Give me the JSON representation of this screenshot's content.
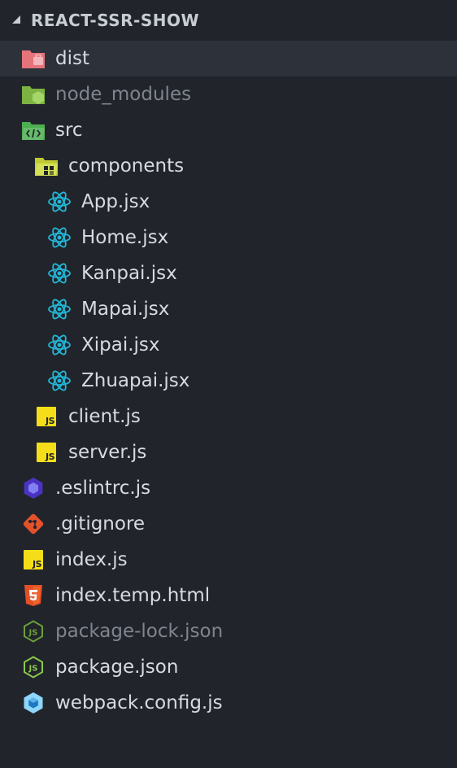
{
  "explorer": {
    "title": "REACT-SSR-SHOW"
  },
  "colors": {
    "background": "#21252b",
    "selected_row": "#2c313a",
    "text": "#d7dae0",
    "dim_text": "#7f848e",
    "react_blue": "#23b7d8",
    "js_yellow": "#f5de19",
    "git_orange": "#e4512b",
    "html_orange": "#e34f26",
    "node_green": "#8cc84b",
    "eslint_purple": "#4b32c3",
    "webpack_blue": "#8ed6fb",
    "dist_red": "#e5737a"
  },
  "tree": {
    "dist": "dist",
    "node_modules": "node_modules",
    "src": "src",
    "components": "components",
    "app": "App.jsx",
    "home": "Home.jsx",
    "kanpai": "Kanpai.jsx",
    "mapai": "Mapai.jsx",
    "xipai": "Xipai.jsx",
    "zhuapai": "Zhuapai.jsx",
    "client": "client.js",
    "server": "server.js",
    "eslintrc": ".eslintrc.js",
    "gitignore": ".gitignore",
    "index_js": "index.js",
    "index_temp": "index.temp.html",
    "package_lock": "package-lock.json",
    "package": "package.json",
    "webpack": "webpack.config.js"
  },
  "icons": {
    "collapse": "chevron-down-icon",
    "dist": "folder-dist-icon",
    "node_modules": "folder-node-icon",
    "src": "folder-src-icon",
    "components": "folder-components-icon",
    "jsx": "react-icon",
    "js": "javascript-icon",
    "eslint": "eslint-icon",
    "git": "git-icon",
    "html": "html5-icon",
    "npm": "nodejs-icon",
    "webpack": "webpack-icon"
  }
}
